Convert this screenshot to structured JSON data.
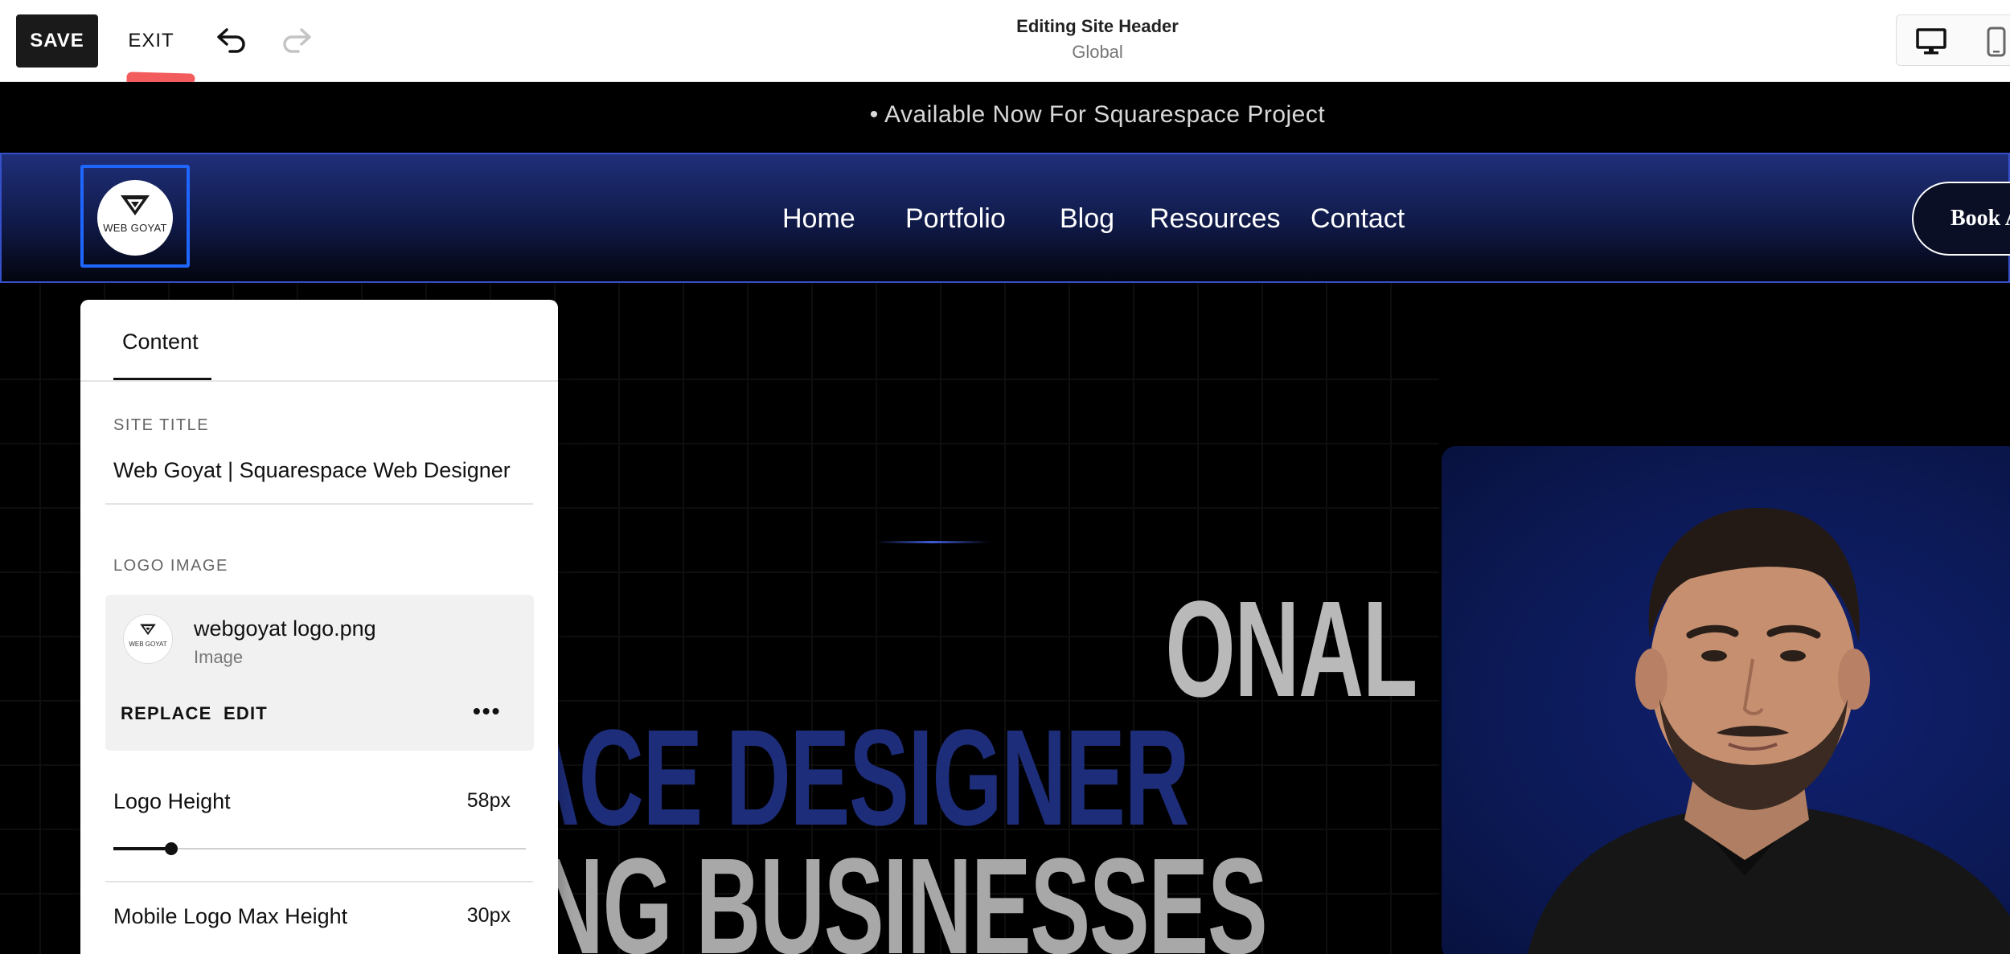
{
  "toolbar": {
    "save_label": "SAVE",
    "exit_label": "EXIT",
    "undo_icon": "undo-icon",
    "redo_icon": "redo-icon",
    "title": "Editing Site Header",
    "subtitle": "Global",
    "device_views": [
      "desktop-icon",
      "mobile-icon"
    ]
  },
  "announcement": {
    "text": "• Available Now For Squarespace Project"
  },
  "site_header": {
    "logo_text": "WEB GOYAT",
    "nav": [
      "Home",
      "Portfolio",
      "Blog",
      "Resources",
      "Contact"
    ],
    "cta_label": "Book A"
  },
  "hero": {
    "line1": "ONAL",
    "line2": "ACE DESIGNER",
    "line3": "ING BUSINESSES"
  },
  "panel": {
    "tab": "Content",
    "site_title_label": "SITE TITLE",
    "site_title_value": "Web Goyat | Squarespace Web Designer",
    "logo_image_label": "LOGO IMAGE",
    "logo_file_name": "webgoyat logo.png",
    "logo_file_type": "Image",
    "logo_thumb_text": "WEB GOYAT",
    "replace_label": "REPLACE",
    "edit_label": "EDIT",
    "more_label": "•••",
    "logo_height_label": "Logo Height",
    "logo_height_value": "58px",
    "logo_height_slider_fraction": 0.14,
    "mobile_logo_label": "Mobile Logo Max Height",
    "mobile_logo_value": "30px"
  },
  "colors": {
    "accent_blue": "#1f66ff",
    "header_blue": "#1f2f7a",
    "annotation_red": "#f25c5c"
  }
}
